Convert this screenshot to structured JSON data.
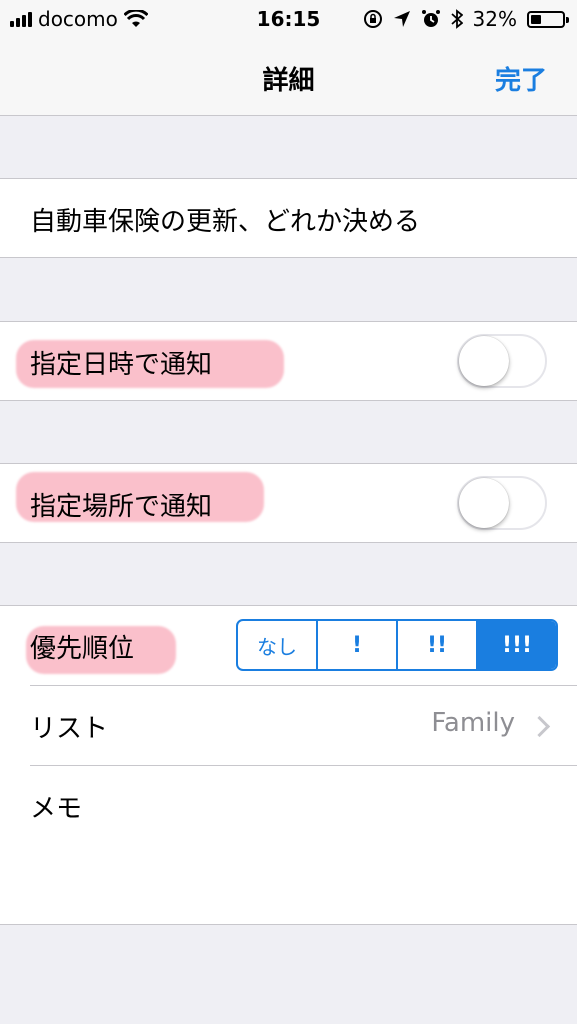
{
  "status_bar": {
    "carrier": "docomo",
    "time": "16:15",
    "battery_percent": "32%",
    "battery_level": 0.32,
    "icons": [
      "signal-icon",
      "wifi-icon",
      "rotation-lock-icon",
      "location-icon",
      "alarm-icon",
      "bluetooth-icon",
      "battery-icon"
    ]
  },
  "nav": {
    "title": "詳細",
    "done_label": "完了"
  },
  "reminder": {
    "title": "自動車保険の更新、どれか決める"
  },
  "notify_date": {
    "label": "指定日時で通知",
    "on": false
  },
  "notify_location": {
    "label": "指定場所で通知",
    "on": false
  },
  "priority": {
    "label": "優先順位",
    "options": [
      "なし",
      "!",
      "!!",
      "!!!"
    ],
    "selected_index": 3
  },
  "list": {
    "label": "リスト",
    "value": "Family"
  },
  "memo": {
    "label": "メモ"
  },
  "colors": {
    "accent": "#1a7ee0",
    "highlight": "#f58ca0",
    "background": "#efeff4"
  }
}
